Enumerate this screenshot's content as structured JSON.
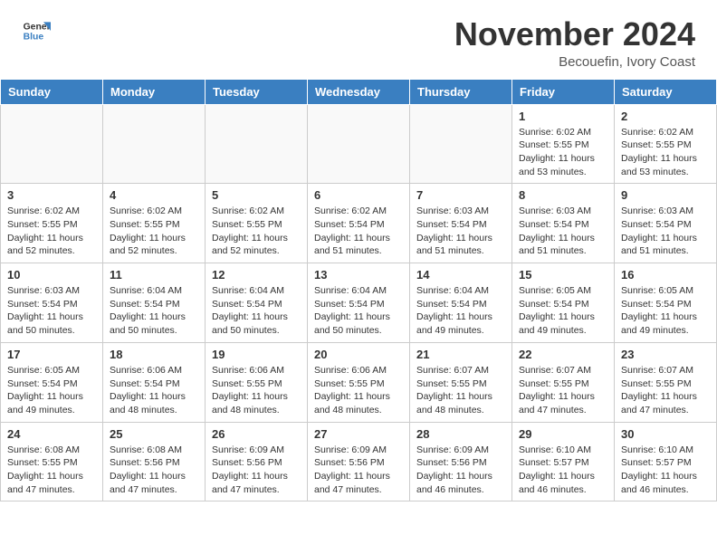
{
  "header": {
    "logo_line1": "General",
    "logo_line2": "Blue",
    "month_title": "November 2024",
    "location": "Becouefin, Ivory Coast"
  },
  "weekdays": [
    "Sunday",
    "Monday",
    "Tuesday",
    "Wednesday",
    "Thursday",
    "Friday",
    "Saturday"
  ],
  "weeks": [
    [
      {
        "day": "",
        "info": ""
      },
      {
        "day": "",
        "info": ""
      },
      {
        "day": "",
        "info": ""
      },
      {
        "day": "",
        "info": ""
      },
      {
        "day": "",
        "info": ""
      },
      {
        "day": "1",
        "info": "Sunrise: 6:02 AM\nSunset: 5:55 PM\nDaylight: 11 hours and 53 minutes."
      },
      {
        "day": "2",
        "info": "Sunrise: 6:02 AM\nSunset: 5:55 PM\nDaylight: 11 hours and 53 minutes."
      }
    ],
    [
      {
        "day": "3",
        "info": "Sunrise: 6:02 AM\nSunset: 5:55 PM\nDaylight: 11 hours and 52 minutes."
      },
      {
        "day": "4",
        "info": "Sunrise: 6:02 AM\nSunset: 5:55 PM\nDaylight: 11 hours and 52 minutes."
      },
      {
        "day": "5",
        "info": "Sunrise: 6:02 AM\nSunset: 5:55 PM\nDaylight: 11 hours and 52 minutes."
      },
      {
        "day": "6",
        "info": "Sunrise: 6:02 AM\nSunset: 5:54 PM\nDaylight: 11 hours and 51 minutes."
      },
      {
        "day": "7",
        "info": "Sunrise: 6:03 AM\nSunset: 5:54 PM\nDaylight: 11 hours and 51 minutes."
      },
      {
        "day": "8",
        "info": "Sunrise: 6:03 AM\nSunset: 5:54 PM\nDaylight: 11 hours and 51 minutes."
      },
      {
        "day": "9",
        "info": "Sunrise: 6:03 AM\nSunset: 5:54 PM\nDaylight: 11 hours and 51 minutes."
      }
    ],
    [
      {
        "day": "10",
        "info": "Sunrise: 6:03 AM\nSunset: 5:54 PM\nDaylight: 11 hours and 50 minutes."
      },
      {
        "day": "11",
        "info": "Sunrise: 6:04 AM\nSunset: 5:54 PM\nDaylight: 11 hours and 50 minutes."
      },
      {
        "day": "12",
        "info": "Sunrise: 6:04 AM\nSunset: 5:54 PM\nDaylight: 11 hours and 50 minutes."
      },
      {
        "day": "13",
        "info": "Sunrise: 6:04 AM\nSunset: 5:54 PM\nDaylight: 11 hours and 50 minutes."
      },
      {
        "day": "14",
        "info": "Sunrise: 6:04 AM\nSunset: 5:54 PM\nDaylight: 11 hours and 49 minutes."
      },
      {
        "day": "15",
        "info": "Sunrise: 6:05 AM\nSunset: 5:54 PM\nDaylight: 11 hours and 49 minutes."
      },
      {
        "day": "16",
        "info": "Sunrise: 6:05 AM\nSunset: 5:54 PM\nDaylight: 11 hours and 49 minutes."
      }
    ],
    [
      {
        "day": "17",
        "info": "Sunrise: 6:05 AM\nSunset: 5:54 PM\nDaylight: 11 hours and 49 minutes."
      },
      {
        "day": "18",
        "info": "Sunrise: 6:06 AM\nSunset: 5:54 PM\nDaylight: 11 hours and 48 minutes."
      },
      {
        "day": "19",
        "info": "Sunrise: 6:06 AM\nSunset: 5:55 PM\nDaylight: 11 hours and 48 minutes."
      },
      {
        "day": "20",
        "info": "Sunrise: 6:06 AM\nSunset: 5:55 PM\nDaylight: 11 hours and 48 minutes."
      },
      {
        "day": "21",
        "info": "Sunrise: 6:07 AM\nSunset: 5:55 PM\nDaylight: 11 hours and 48 minutes."
      },
      {
        "day": "22",
        "info": "Sunrise: 6:07 AM\nSunset: 5:55 PM\nDaylight: 11 hours and 47 minutes."
      },
      {
        "day": "23",
        "info": "Sunrise: 6:07 AM\nSunset: 5:55 PM\nDaylight: 11 hours and 47 minutes."
      }
    ],
    [
      {
        "day": "24",
        "info": "Sunrise: 6:08 AM\nSunset: 5:55 PM\nDaylight: 11 hours and 47 minutes."
      },
      {
        "day": "25",
        "info": "Sunrise: 6:08 AM\nSunset: 5:56 PM\nDaylight: 11 hours and 47 minutes."
      },
      {
        "day": "26",
        "info": "Sunrise: 6:09 AM\nSunset: 5:56 PM\nDaylight: 11 hours and 47 minutes."
      },
      {
        "day": "27",
        "info": "Sunrise: 6:09 AM\nSunset: 5:56 PM\nDaylight: 11 hours and 47 minutes."
      },
      {
        "day": "28",
        "info": "Sunrise: 6:09 AM\nSunset: 5:56 PM\nDaylight: 11 hours and 46 minutes."
      },
      {
        "day": "29",
        "info": "Sunrise: 6:10 AM\nSunset: 5:57 PM\nDaylight: 11 hours and 46 minutes."
      },
      {
        "day": "30",
        "info": "Sunrise: 6:10 AM\nSunset: 5:57 PM\nDaylight: 11 hours and 46 minutes."
      }
    ]
  ]
}
